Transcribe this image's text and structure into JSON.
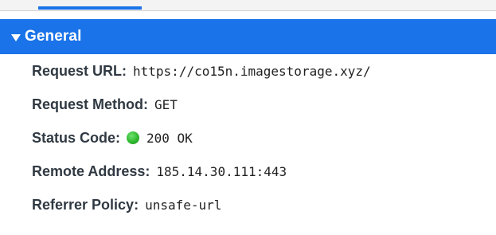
{
  "section": {
    "title": "General",
    "expanded": true,
    "color": "#1a73e8"
  },
  "rows": [
    {
      "label": "Request URL:",
      "value": "https://co15n.imagestorage.xyz/"
    },
    {
      "label": "Request Method:",
      "value": "GET"
    },
    {
      "label": "Status Code:",
      "value": "200 OK",
      "status_icon": "green-dot-icon",
      "status_color": "#2fb82f"
    },
    {
      "label": "Remote Address:",
      "value": "185.14.30.111:443"
    },
    {
      "label": "Referrer Policy:",
      "value": "unsafe-url"
    }
  ]
}
